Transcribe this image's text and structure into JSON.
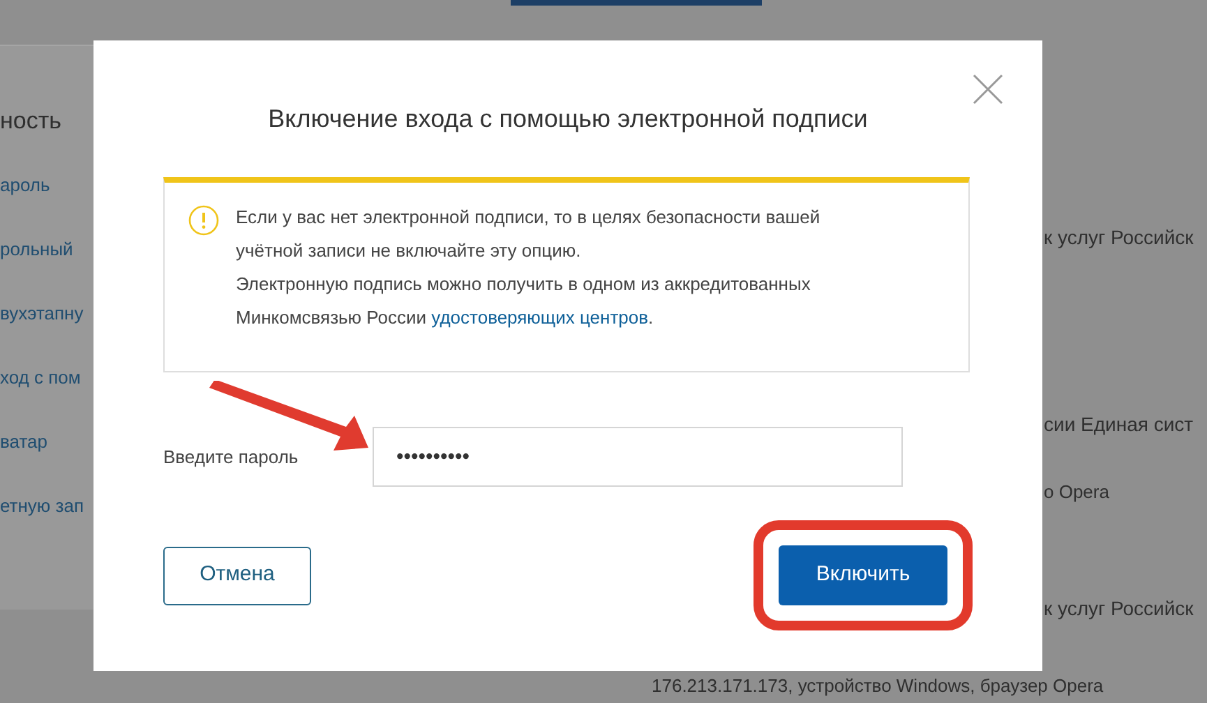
{
  "background": {
    "left_items": [
      {
        "text": "ность",
        "kind": "heading"
      },
      {
        "text": "ароль",
        "kind": "link"
      },
      {
        "text": "рольный",
        "kind": "link"
      },
      {
        "text": "вухэтапну",
        "kind": "link"
      },
      {
        "text": "ход с пом",
        "kind": "link"
      },
      {
        "text": "ватар",
        "kind": "link"
      },
      {
        "text": "етную зап",
        "kind": "link"
      }
    ],
    "right_items": [
      {
        "text": "к услуг Российск",
        "kind": "large"
      },
      {
        "text": "сии Единая сист",
        "kind": "large"
      },
      {
        "text": "о Opera",
        "kind": "small"
      },
      {
        "text": "к услуг Российск",
        "kind": "large"
      }
    ],
    "bottom_line": "176.213.171.173, устройство Windows, браузер Opera"
  },
  "dialog": {
    "title": "Включение входа с помощью электронной подписи",
    "warning": {
      "lines": [
        "Если у вас нет электронной подписи, то в целях безопасности вашей",
        "учётной записи не включайте эту опцию.",
        "Электронную подпись можно получить в одном из аккредитованных"
      ],
      "last_line": "Минкомсвязью России ",
      "link": "удостоверяющих центров",
      "after_link": "."
    },
    "password": {
      "label": "Введите пароль",
      "value": "••••••••••"
    },
    "buttons": [
      {
        "label": "Отмена",
        "kind": "secondary"
      },
      {
        "label": "Включить",
        "kind": "primary",
        "highlighted": true
      }
    ]
  }
}
